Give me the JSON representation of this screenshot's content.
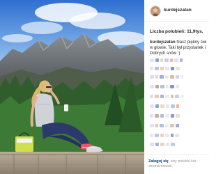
{
  "post": {
    "username": "kurdejszatan",
    "avatar_icon": "profile-avatar"
  },
  "likes": {
    "text": "Liczba polubień: 11,9tys."
  },
  "caption": {
    "user": "kurdejszatan",
    "line1": " Nasz piękny świ",
    "line2": "w głowie. Taki był przystanek i",
    "line3": "Dobrych snów :)"
  },
  "footer": {
    "login_link": "Zaloguj się",
    "after_link": ", aby polubić lub",
    "line2": "skomentować."
  },
  "colors": {
    "link": "#003569",
    "muted": "#999999",
    "text": "#262626"
  }
}
